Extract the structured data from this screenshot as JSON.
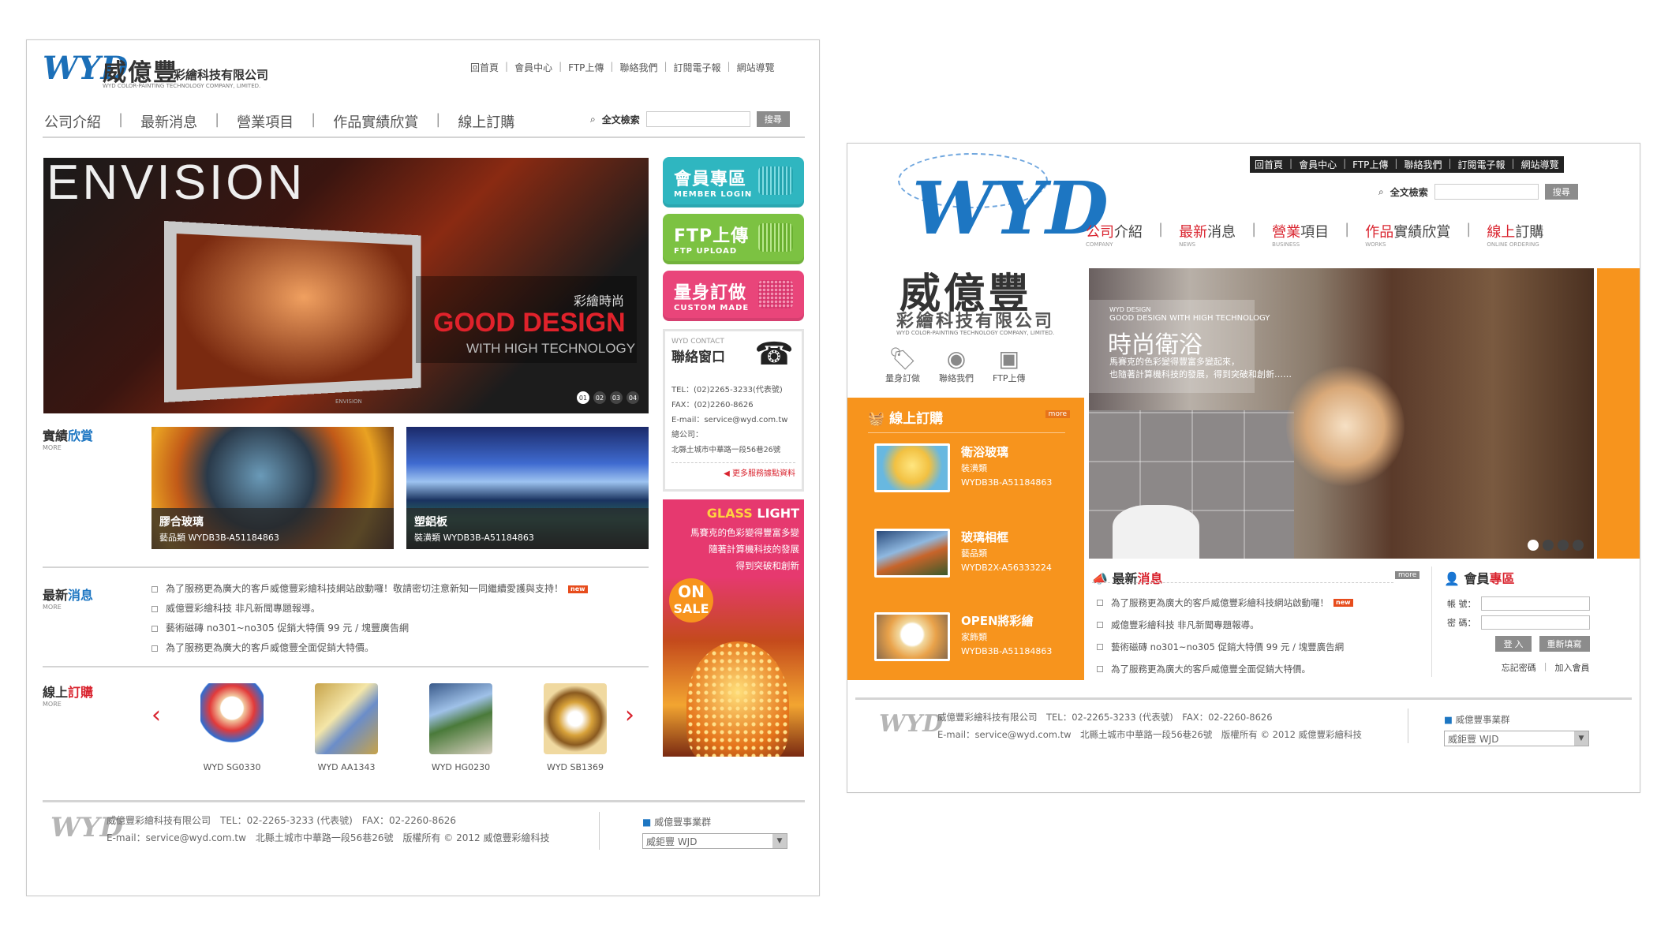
{
  "design1": {
    "logo": {
      "mark": "WYD",
      "name": "威億豐",
      "tagline": "彩繪科技有限公司",
      "en": "WYD COLOR-PAINTING TECHNOLOGY COMPANY, LIMITED."
    },
    "toplinks": [
      "回首頁",
      "會員中心",
      "FTP上傳",
      "聯絡我們",
      "訂閱電子報",
      "網站導覽"
    ],
    "nav": [
      "公司介紹",
      "最新消息",
      "營業項目",
      "作品實績欣賞",
      "線上訂購"
    ],
    "search": {
      "label": "全文檢索",
      "button": "搜尋"
    },
    "hero": {
      "brand": "ENVISION",
      "tag": "彩繪時尚",
      "headline": "GOOD DESIGN",
      "sub": "WITH HIGH TECHNOLOGY",
      "tv_brand": "ENVISION",
      "pages": [
        "01",
        "02",
        "03",
        "04"
      ]
    },
    "side": {
      "member": {
        "title": "會員專區",
        "sub": "MEMBER LOGIN"
      },
      "ftp": {
        "title": "FTP上傳",
        "sub": "FTP UPLOAD"
      },
      "custom": {
        "title": "量身訂做",
        "sub": "CUSTOM MADE"
      }
    },
    "contact": {
      "en": "WYD CONTACT",
      "title": "聯絡窗口",
      "tel": "TEL：(02)2265-3233(代表號)",
      "fax": "FAX：(02)2260-8626",
      "email": "E-mail：service@wyd.com.tw",
      "addr1": "總公司：",
      "addr2": "北縣土城市中華路一段56巷26號",
      "more": "更多服務據點資料"
    },
    "promo": {
      "title_a": "GLASS",
      "title_b": "LIGHT",
      "l1": "馬賽克的色彩變得豐富多變",
      "l2": "隨著計算機科技的發展",
      "l3": "得到突破和創新",
      "on": "ON",
      "sale": "SALE"
    },
    "works": {
      "title_a": "實績",
      "title_b": "欣賞",
      "more": "MORE",
      "items": [
        {
          "name": "膠合玻璃",
          "code": "藝品類    WYDB3B-A51184863"
        },
        {
          "name": "塑鋁板",
          "code": "裝潢類    WYDB3B-A51184863"
        }
      ]
    },
    "news": {
      "title_a": "最新",
      "title_b": "消息",
      "more": "MORE",
      "new_tag": "new",
      "items": [
        "為了服務更為廣大的客戶威億豐彩繪科技網站啟動囉！敬請密切注意新知一同繼續愛護與支持！",
        "威億豐彩繪科技 非凡新聞專題報導。",
        "藝術磁磚 no301~no305 促銷大特價 99 元 / 塊豐廣告網",
        "為了服務更為廣大的客戶威億豐全面促銷大特價。"
      ]
    },
    "order": {
      "title_a": "線上",
      "title_b": "訂購",
      "more": "MORE",
      "prev": "‹",
      "next": "›",
      "items": [
        "WYD SG0330",
        "WYD AA1343",
        "WYD HG0230",
        "WYD SB1369"
      ]
    },
    "footer": {
      "line1": "威億豐彩繪科技有限公司　TEL：02-2265-3233 (代表號)　FAX：02-2260-8626",
      "line2": "E-mail：service@wyd.com.tw　北縣土城市中華路一段56巷26號　版權所有 © 2012 威億豐彩繪科技",
      "group": "威億豐事業群",
      "select": "威鉅豐 WJD"
    }
  },
  "design2": {
    "logo": {
      "mark": "WYD",
      "name": "威億豐",
      "tagline": "彩繪科技有限公司",
      "en": "WYD COLOR-PAINTING TECHNOLOGY COMPANY, LIMITED."
    },
    "toplinks": [
      "回首頁",
      "會員中心",
      "FTP上傳",
      "聯絡我們",
      "訂閱電子報",
      "網站導覽"
    ],
    "search": {
      "label": "全文檢索",
      "button": "搜尋"
    },
    "nav": [
      {
        "a": "公司",
        "b": "介紹",
        "en": "COMPANY"
      },
      {
        "a": "最新",
        "b": "消息",
        "en": "NEWS"
      },
      {
        "a": "營業",
        "b": "項目",
        "en": "BUSINESS"
      },
      {
        "a": "作品",
        "b": "實績欣賞",
        "en": "WORKS"
      },
      {
        "a": "線上",
        "b": "訂購",
        "en": "ONLINE ORDERING"
      }
    ],
    "quick": [
      "量身訂做",
      "聯絡我們",
      "FTP上傳"
    ],
    "hero": {
      "en1": "WYD DESIGN",
      "en2": "GOOD DESIGN WITH HIGH TECHNOLOGY",
      "title": "時尚衛浴",
      "l1": "馬賽克的色彩變得豐富多變起來，",
      "l2": "也隨著計算機科技的發展，得到突破和創新……"
    },
    "order": {
      "title": "線上訂購",
      "more": "more",
      "items": [
        {
          "name": "衛浴玻璃",
          "cat": "裝潢類",
          "code": "WYDB3B-A51184863"
        },
        {
          "name": "玻璃相框",
          "cat": "藝品類",
          "code": "WYDB2X-A56333224"
        },
        {
          "name": "OPEN將彩繪",
          "cat": "家飾類",
          "code": "WYDB3B-A51184863"
        }
      ]
    },
    "news": {
      "title_a": "最新",
      "title_b": "消息",
      "more": "more",
      "new_tag": "new",
      "items": [
        "為了服務更為廣大的客戶威億豐彩繪科技網站啟動囉！",
        "威億豐彩繪科技 非凡新聞專題報導。",
        "藝術磁磚 no301~no305 促銷大特價 99 元 / 塊豐廣告網",
        "為了服務更為廣大的客戶威億豐全面促銷大特價。"
      ]
    },
    "member": {
      "title_a": "會員",
      "title_b": "專區",
      "account": "帳 號：",
      "password": "密 碼：",
      "login": "登 入",
      "reset": "重新填寫",
      "forgot": "忘記密碼",
      "join": "加入會員"
    },
    "footer": {
      "line1": "威億豐彩繪科技有限公司　TEL：02-2265-3233 (代表號)　FAX：02-2260-8626",
      "line2": "E-mail：service@wyd.com.tw　北縣土城市中華路一段56巷26號　版權所有 © 2012 威億豐彩繪科技",
      "group": "威億豐事業群",
      "select": "威鉅豐 WJD"
    }
  },
  "colors": {
    "blue": "#1d76c2",
    "red": "#d9232e",
    "orange": "#f7941d",
    "teal": "#2fb6c0",
    "green": "#7cc242",
    "pink": "#e9457a"
  }
}
